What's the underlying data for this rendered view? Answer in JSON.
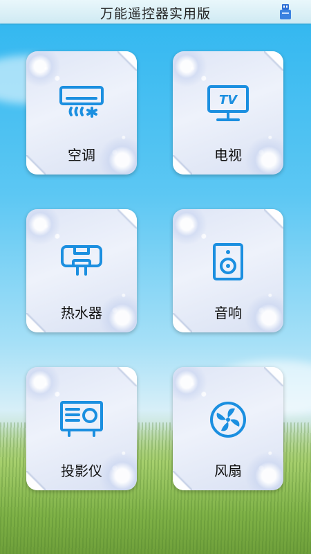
{
  "header": {
    "title": "万能遥控器实用版",
    "right_icon": "usb-icon"
  },
  "tiles": [
    {
      "label": "空调",
      "icon": "air-conditioner-icon"
    },
    {
      "label": "电视",
      "icon": "tv-icon",
      "icon_text": "TV"
    },
    {
      "label": "热水器",
      "icon": "water-heater-icon"
    },
    {
      "label": "音响",
      "icon": "speaker-icon"
    },
    {
      "label": "投影仪",
      "icon": "projector-icon"
    },
    {
      "label": "风扇",
      "icon": "fan-icon"
    }
  ],
  "colors": {
    "icon_blue": "#1b8fe0",
    "topbar": "#dff2f8"
  }
}
